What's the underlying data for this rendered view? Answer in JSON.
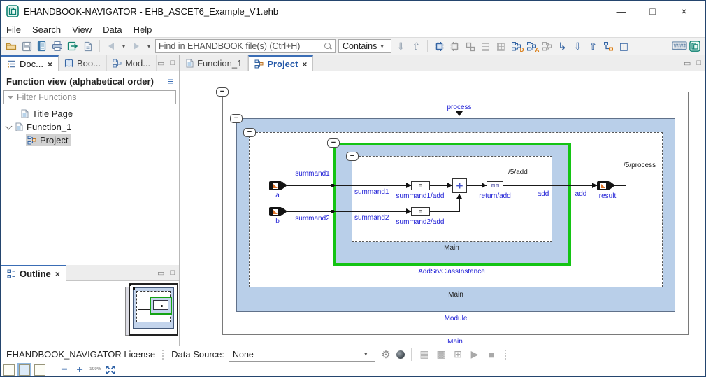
{
  "window": {
    "title": "EHANDBOOK-NAVIGATOR - EHB_ASCET6_Example_V1.ehb",
    "minimize_glyph": "—",
    "maximize_glyph": "□",
    "close_glyph": "×"
  },
  "menu": {
    "items": [
      "File",
      "Search",
      "View",
      "Data",
      "Help"
    ]
  },
  "toolbar": {
    "find_placeholder": "Find in EHANDBOOK file(s) (Ctrl+H)",
    "contains_label": "Contains",
    "dropdown_glyph": "▾",
    "icon_names": [
      "open",
      "save",
      "handbook",
      "print",
      "export",
      "pdf",
      "back",
      "back-menu",
      "forward",
      "forward-menu",
      "search",
      "contains-filter",
      "find-next",
      "find-previous",
      "ecu-model",
      "ecu-model-secondary",
      "ecu-model-small",
      "list-view",
      "table-view",
      "hierarchy-definitions",
      "hierarchy-annotations",
      "hierarchy-disabled",
      "goto-reference",
      "jump-down",
      "jump-up",
      "hierarchy-navigate",
      "new-window",
      "keyboard-shortcuts",
      "ehandbook"
    ],
    "glyphs": {
      "find_down": "⇩",
      "find_up": "⇧",
      "list": "▤",
      "table": "▦",
      "goto": "↳",
      "window": "◫",
      "keyboard": "⌨"
    }
  },
  "sidebar": {
    "tabs": {
      "documents": "Doc...",
      "bookmarks": "Boo...",
      "model": "Mod..."
    },
    "close_glyph": "×",
    "min_glyph": "▭",
    "max_glyph": "□",
    "heading": "Function view (alphabetical order)",
    "view_menu_glyph": "≡",
    "filter_placeholder": "Filter Functions",
    "tree": {
      "title_page": "Title Page",
      "function_1": "Function_1",
      "project": "Project"
    }
  },
  "outline": {
    "tab_label": "Outline",
    "close_glyph": "×",
    "min_glyph": "▭",
    "max_glyph": "□"
  },
  "editor": {
    "tabs": {
      "function_1": "Function_1",
      "project": "Project"
    },
    "close_glyph": "×",
    "min_glyph": "▭",
    "max_glyph": "□"
  },
  "diagram": {
    "collapse_glyph": "−",
    "process_label": "process",
    "module_label": "Module",
    "outer_main_label": "Main",
    "module_main_label": "Main",
    "green_main_label": "Main",
    "green_box_label": "AddSrvClassInstance",
    "port_a_label": "a",
    "port_b_label": "b",
    "wire1_label": "summand1",
    "wire2_label": "summand2",
    "inner_wire1_label": "summand1",
    "inner_wire2_label": "summand2",
    "block1_label": "summand1/add",
    "block2_label": "summand2/add",
    "plus_glyph": "+",
    "return_label": "return/add",
    "add_inner_label": "add",
    "add_outer_label": "add",
    "result_label": "result",
    "path_add_label": "/5/add",
    "path_process_label": "/5/process"
  },
  "statusbar": {
    "license_label": "EHANDBOOK_NAVIGATOR License",
    "data_source_label": "Data Source:",
    "data_source_value": "None",
    "dropdown_glyph": "▾",
    "glyphs": {
      "gear": "⚙",
      "grid_a": "▦",
      "grid_b": "▩",
      "grid_c": "⊞",
      "play": "▶",
      "stop": "■"
    },
    "zoom_out_glyph": "−",
    "zoom_in_glyph": "+",
    "zoom_level": "100%",
    "icon_names": [
      "settings",
      "visualization",
      "measure-grid",
      "measure-config",
      "measure-window",
      "start-measurement",
      "stop-measurement",
      "single-page-view",
      "split-page-view",
      "thumbnail-page-view",
      "zoom-out",
      "zoom-in",
      "zoom-100",
      "fit-to-screen"
    ]
  }
}
